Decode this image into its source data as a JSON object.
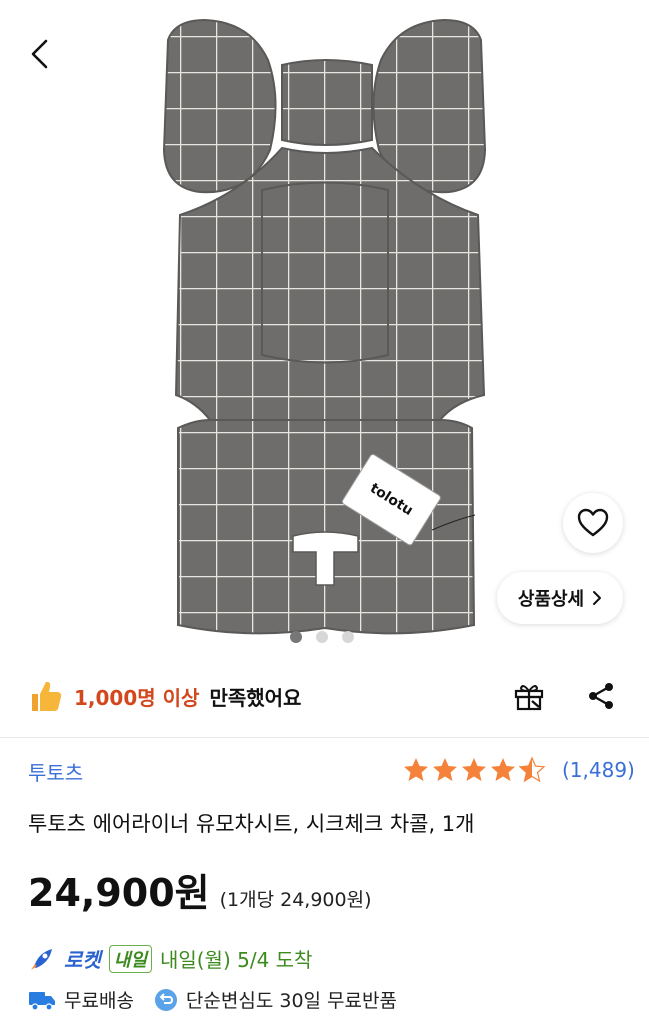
{
  "header": {
    "back_icon": "chevron-left-icon"
  },
  "gallery": {
    "page_count": 3,
    "current_page": 1,
    "detail_button_label": "상품상세",
    "tag_text": "tolotu"
  },
  "satisfaction": {
    "highlight": "1,000명 이상",
    "rest": "만족했어요"
  },
  "product": {
    "brand": "투토츠",
    "title": "투토츠 에어라이너 유모차시트, 시크체크 차콜, 1개",
    "price": "24,900원",
    "unit_price": "(1개당 24,900원)"
  },
  "rating": {
    "stars": 4.5,
    "count": "(1,489)"
  },
  "delivery": {
    "rocket_label": "로켓",
    "badge": "내일",
    "arrival": "내일(월) 5/4 도착",
    "free_shipping": "무료배송",
    "returns": "단순변심도 30일 무료반품"
  },
  "colors": {
    "accent_blue": "#3a6fd8",
    "highlight_orange": "#d2471c",
    "delivery_green": "#3d8b1f",
    "star": "#f4823a"
  }
}
